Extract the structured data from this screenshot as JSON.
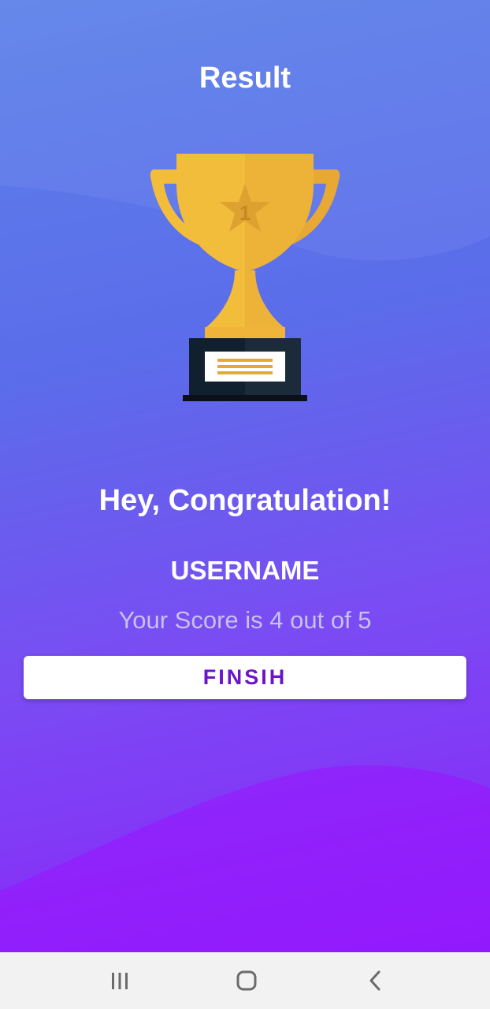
{
  "header": {
    "title": "Result"
  },
  "trophy": {
    "icon": "trophy-icon",
    "badge_number": "1",
    "colors": {
      "cup": "#f3bd3c",
      "cup_shade": "#e8a934",
      "base": "#112233",
      "plate": "#ffffff",
      "plate_lines": "#e8a934"
    }
  },
  "result": {
    "greeting": "Hey, Congratulation!",
    "username": "USERNAME",
    "score_text": "Your Score is 4 out of 5"
  },
  "actions": {
    "finish_label": "FINSIH"
  },
  "navbar": {
    "recents_icon": "recent-apps-icon",
    "home_icon": "home-icon",
    "back_icon": "back-icon"
  },
  "colors": {
    "background_top": "#5d82e9",
    "background_bottom": "#8e1bfb",
    "button_text": "#6c14c9",
    "score_text": "#c9c0ee"
  }
}
